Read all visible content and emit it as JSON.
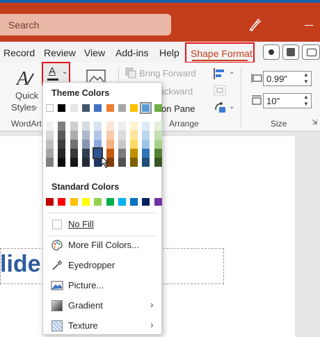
{
  "titlebar": {
    "search_placeholder": "Search",
    "accent": "#c43e1c"
  },
  "tabs": [
    {
      "label": "Record"
    },
    {
      "label": "Review"
    },
    {
      "label": "View"
    },
    {
      "label": "Add-ins"
    },
    {
      "label": "Help"
    }
  ],
  "active_tab": {
    "label": "Shape Format",
    "highlight": "#e4141b"
  },
  "ribbon": {
    "quick_styles": "Quick",
    "quick_styles_2": "Styles",
    "wordart_group": "WordArt S",
    "bring_forward": "Bring Forward",
    "send_backward": "Backward",
    "selection_pane": "on Pane",
    "arrange_group": "Arrange",
    "height_value": "0.99\"",
    "width_value": "10\"",
    "size_group": "Size"
  },
  "dropdown": {
    "theme_heading": "Theme Colors",
    "standard_heading": "Standard Colors",
    "no_fill": "No Fill",
    "more_colors": "More Fill Colors...",
    "eyedropper": "Eyedropper",
    "picture": "Picture...",
    "gradient": "Gradient",
    "texture": "Texture",
    "theme_top": [
      "#ffffff",
      "#000000",
      "#e7e6e6",
      "#44546a",
      "#4472c4",
      "#ed7d31",
      "#a5a5a5",
      "#ffc000",
      "#5b9bd5",
      "#70ad47"
    ],
    "theme_shades": [
      [
        "#f2f2f2",
        "#7f7f7f",
        "#d0cece",
        "#d6dce4",
        "#d9e2f3",
        "#fbe5d5",
        "#ededed",
        "#fff2cc",
        "#ddebf7",
        "#e2efd9"
      ],
      [
        "#d8d8d8",
        "#595959",
        "#aeabab",
        "#adb9ca",
        "#b4c6e7",
        "#f7cbac",
        "#dbdbdb",
        "#fee599",
        "#bdd7ee",
        "#c5e0b3"
      ],
      [
        "#bfbfbf",
        "#3f3f3f",
        "#757070",
        "#8496b0",
        "#8eaadb",
        "#f4b183",
        "#c9c9c9",
        "#ffd965",
        "#9dc3e6",
        "#a8d08d"
      ],
      [
        "#a5a5a5",
        "#262626",
        "#3a3838",
        "#323f4f",
        "#2f5496",
        "#c55a11",
        "#7b7b7b",
        "#bf9000",
        "#2e75b5",
        "#538135"
      ],
      [
        "#7f7f7f",
        "#0c0c0c",
        "#171616",
        "#222a35",
        "#1f3864",
        "#833c0b",
        "#525252",
        "#7f6000",
        "#1e4e79",
        "#375623"
      ]
    ],
    "standard": [
      "#c00000",
      "#ff0000",
      "#ffc000",
      "#ffff00",
      "#92d050",
      "#00b050",
      "#00b0f0",
      "#0070c0",
      "#002060",
      "#7030a0"
    ]
  },
  "slide": {
    "title_fragment": "lide I"
  }
}
